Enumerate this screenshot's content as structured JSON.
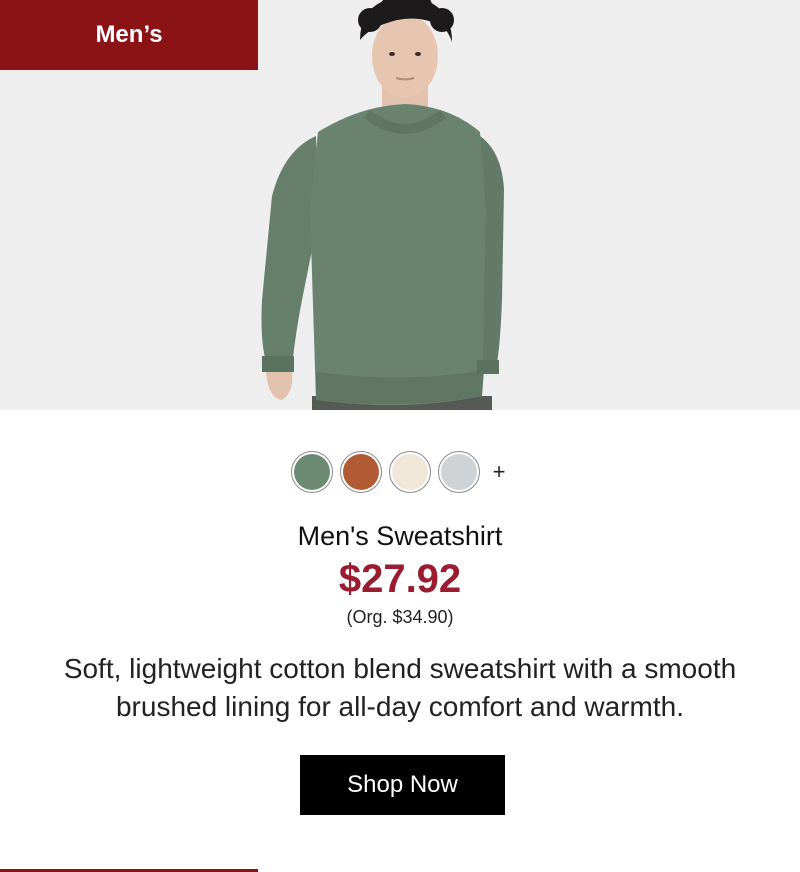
{
  "category": {
    "label": "Men’s",
    "color": "#8b1316"
  },
  "hero": {
    "alt": "Model wearing green crewneck sweatshirt"
  },
  "swatches": [
    {
      "name": "green",
      "color": "#6c8b72"
    },
    {
      "name": "terracotta",
      "color": "#b15b35"
    },
    {
      "name": "ivory",
      "color": "#f1e7d8"
    },
    {
      "name": "heather-gray",
      "color": "#cfd3d6"
    }
  ],
  "more_colors_label": "+",
  "product": {
    "title": "Men's Sweatshirt",
    "price": "$27.92",
    "original_price": "(Org. $34.90)",
    "price_color": "#9b1b30",
    "description": "Soft, lightweight cotton blend sweatshirt with a smooth brushed lining for all-day comfort and warmth."
  },
  "cta": {
    "label": "Shop Now"
  }
}
